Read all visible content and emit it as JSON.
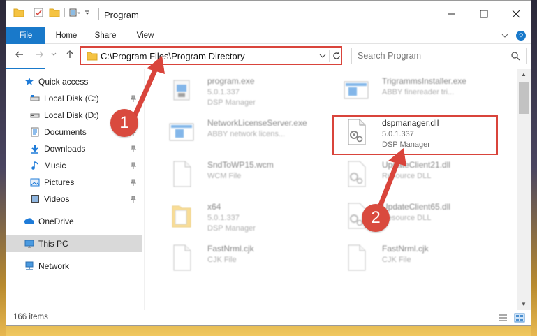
{
  "window": {
    "title": "Program",
    "tabs": {
      "file": "File",
      "home": "Home",
      "share": "Share",
      "view": "View"
    }
  },
  "address": {
    "path": "C:\\Program Files\\Program Directory",
    "search_placeholder": "Search Program"
  },
  "sidebar": {
    "items": [
      {
        "label": "Quick access",
        "icon": "star-icon"
      },
      {
        "label": "Local Disk (C:)",
        "icon": "drive-icon"
      },
      {
        "label": "Local Disk (D:)",
        "icon": "drive-icon"
      },
      {
        "label": "Documents",
        "icon": "documents-icon"
      },
      {
        "label": "Downloads",
        "icon": "download-icon"
      },
      {
        "label": "Music",
        "icon": "music-icon"
      },
      {
        "label": "Pictures",
        "icon": "pictures-icon"
      },
      {
        "label": "Videos",
        "icon": "videos-icon"
      },
      {
        "label": "OneDrive",
        "icon": "cloud-icon"
      },
      {
        "label": "This PC",
        "icon": "computer-icon"
      },
      {
        "label": "Network",
        "icon": "network-icon"
      }
    ]
  },
  "files": [
    {
      "name": "program.exe",
      "line2": "5.0.1.337",
      "line3": "DSP Manager"
    },
    {
      "name": "TrigrammsInstaller.exe",
      "line2": "ABBY finereader tri...",
      "line3": ""
    },
    {
      "name": "NetworkLicenseServer.exe",
      "line2": "ABBY network licens...",
      "line3": ""
    },
    {
      "name": "dspmanager.dll",
      "line2": "5.0.1.337",
      "line3": "DSP Manager"
    },
    {
      "name": "SndToWP15.wcm",
      "line2": "WCM File",
      "line3": ""
    },
    {
      "name": "UpdateClient21.dll",
      "line2": "Resource DLL",
      "line3": ""
    },
    {
      "name": "x64",
      "line2": "5.0.1.337",
      "line3": "DSP Manager"
    },
    {
      "name": "UpdateClient65.dll",
      "line2": "Resource DLL",
      "line3": ""
    },
    {
      "name": "FastNrml.cjk",
      "line2": "CJK File",
      "line3": ""
    },
    {
      "name": "FastNrml.cjk",
      "line2": "CJK File",
      "line3": ""
    }
  ],
  "status": {
    "items_count": "166 items"
  },
  "annotations": {
    "step1": "1",
    "step2": "2"
  },
  "colors": {
    "accent": "#1979ca",
    "highlight": "#d9443b",
    "selection": "#d9d9d9"
  }
}
